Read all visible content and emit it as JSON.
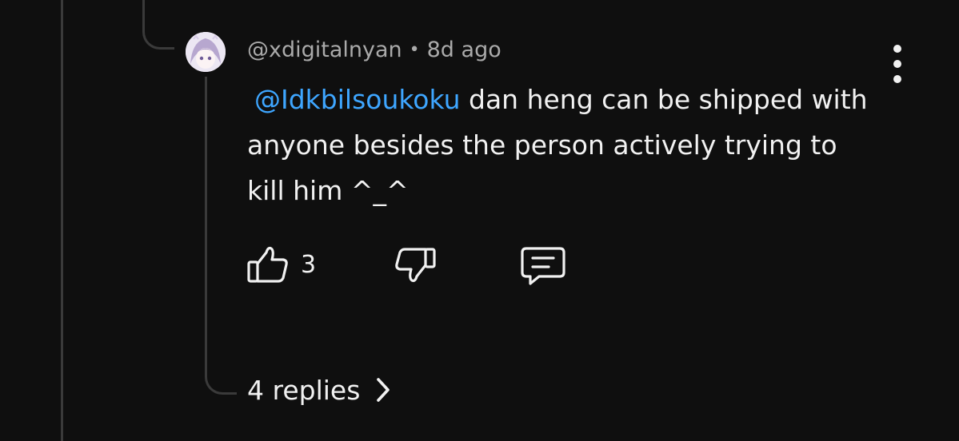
{
  "comment": {
    "author": "@xdigitalnyan",
    "separator": "•",
    "time": "8d ago",
    "mention": "@Idkbilsoukoku",
    "text": " dan heng can be shipped with anyone besides the person actively trying to kill him ^_^",
    "like_count": "3",
    "replies_label": "4 replies"
  },
  "icons": {
    "like": "thumbs-up-icon",
    "dislike": "thumbs-down-icon",
    "reply": "comment-icon",
    "more": "vertical-ellipsis-icon",
    "expand": "chevron-right-icon"
  },
  "colors": {
    "background": "#0f0f0f",
    "text": "#f1f1f1",
    "secondary_text": "#aaaaaa",
    "mention": "#3ea6ff",
    "thread_line": "#3a3a3a"
  }
}
